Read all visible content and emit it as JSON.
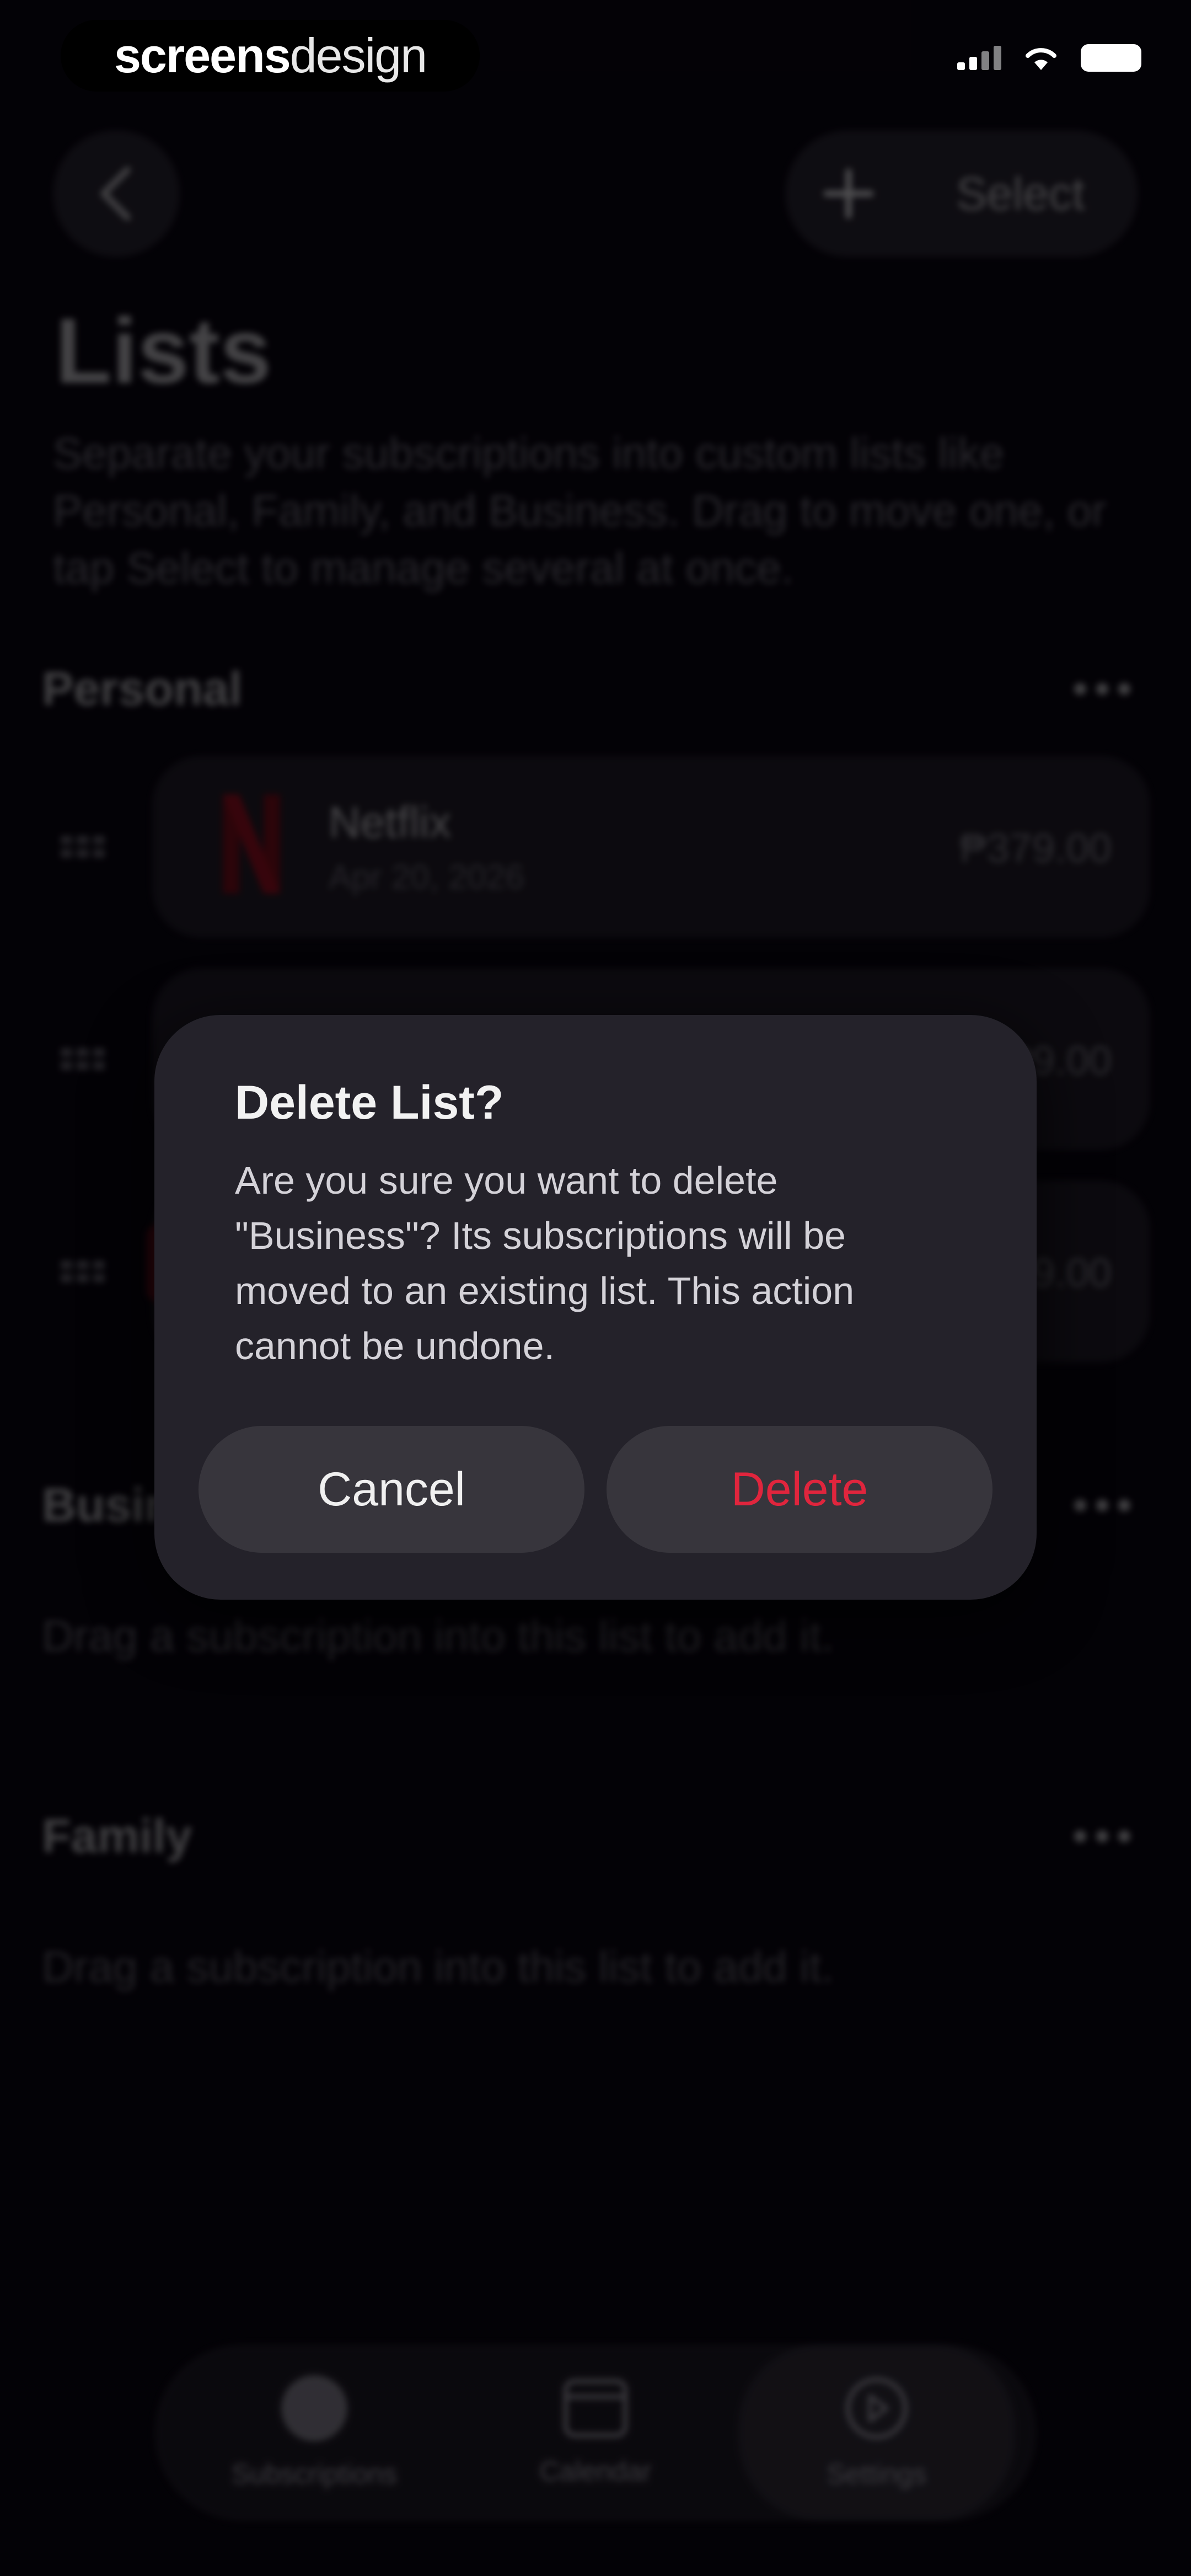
{
  "watermark": {
    "bold": "screens",
    "light": "design"
  },
  "status_bar": {
    "icons": [
      "signal-icon",
      "wifi-icon",
      "battery-icon"
    ]
  },
  "nav": {
    "back_icon": "chevron-left-icon",
    "add_icon": "plus-icon",
    "select_label": "Select"
  },
  "page": {
    "title": "Lists",
    "description": "Separate your subscriptions into custom lists like Personal, Family, and Business. Drag to move one, or tap Select to manage several at once."
  },
  "sections": {
    "personal": {
      "title": "Personal",
      "items": [
        {
          "name": "Netflix",
          "date": "Apr 20, 2026",
          "price": "₱379.00",
          "icon": "netflix-icon"
        },
        {
          "name": "",
          "date": "",
          "price": "₱9.00",
          "icon": ""
        },
        {
          "name": "",
          "date": "",
          "price": "₱9.00",
          "icon": ""
        }
      ]
    },
    "business": {
      "title": "Business",
      "empty_hint": "Drag a subscription into this list to add it."
    },
    "family": {
      "title": "Family",
      "empty_hint": "Drag a subscription into this list to add it."
    }
  },
  "dialog": {
    "title": "Delete List?",
    "body": "Are you sure you want to delete \"Business\"? Its subscriptions will be moved to an existing list. This action cannot be undone.",
    "cancel_label": "Cancel",
    "delete_label": "Delete"
  },
  "tabbar": {
    "tabs": [
      {
        "label": "Subscriptions",
        "icon": "subscriptions-icon"
      },
      {
        "label": "Calendar",
        "icon": "calendar-icon"
      },
      {
        "label": "Settings",
        "icon": "settings-icon"
      }
    ]
  },
  "colors": {
    "background": "#050309",
    "card": "#221f26",
    "dialog": "#24222a",
    "delete_red": "#e0253d",
    "netflix_red": "#b0101c"
  }
}
